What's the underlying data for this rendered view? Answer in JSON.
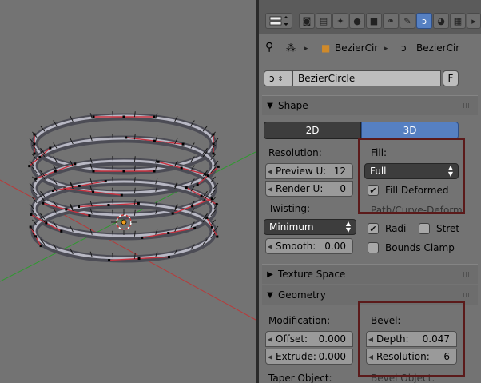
{
  "breadcrumb": {
    "object_name": "BezierCir",
    "curve_name": "BezierCir"
  },
  "datablock": {
    "name": "BezierCircle",
    "fake_user": "F"
  },
  "shape_panel": {
    "title": "Shape",
    "mode_2d": "2D",
    "mode_3d": "3D",
    "resolution_label": "Resolution:",
    "preview_u": {
      "label": "Preview U:",
      "value": "12"
    },
    "render_u": {
      "label": "Render U:",
      "value": "0"
    },
    "twisting_label": "Twisting:",
    "twisting_value": "Minimum",
    "smooth": {
      "label": "Smooth:",
      "value": "0.00"
    },
    "fill_label": "Fill:",
    "fill_value": "Full",
    "fill_deformed": "Fill Deformed",
    "path_deform": "Path/Curve-Deform:",
    "radius": "Radi",
    "stretch": "Stret",
    "bounds_clamp": "Bounds Clamp"
  },
  "texture_panel": {
    "title": "Texture Space"
  },
  "geometry_panel": {
    "title": "Geometry",
    "modification_label": "Modification:",
    "offset": {
      "label": "Offset:",
      "value": "0.000"
    },
    "extrude": {
      "label": "Extrude:",
      "value": "0.000"
    },
    "bevel_label": "Bevel:",
    "depth": {
      "label": "Depth:",
      "value": "0.047"
    },
    "resolution": {
      "label": "Resolution:",
      "value": "6"
    },
    "taper_label": "Taper Object:",
    "bevel_object_label": "Bevel Object:"
  },
  "colors": {
    "accent_blue": "#5680c2",
    "highlight_box": "#5b1a1a",
    "axis_red": "#c0392b",
    "axis_green": "#2e9a2e"
  },
  "icons": [
    "pin-icon",
    "curve-data-icon",
    "cube-icon",
    "chevron-right-icon",
    "curve-icon",
    "render-icon",
    "scene-icon",
    "world-icon",
    "object-icon",
    "constraints-icon",
    "modifiers-icon",
    "data-icon",
    "material-icon",
    "texture-icon"
  ]
}
